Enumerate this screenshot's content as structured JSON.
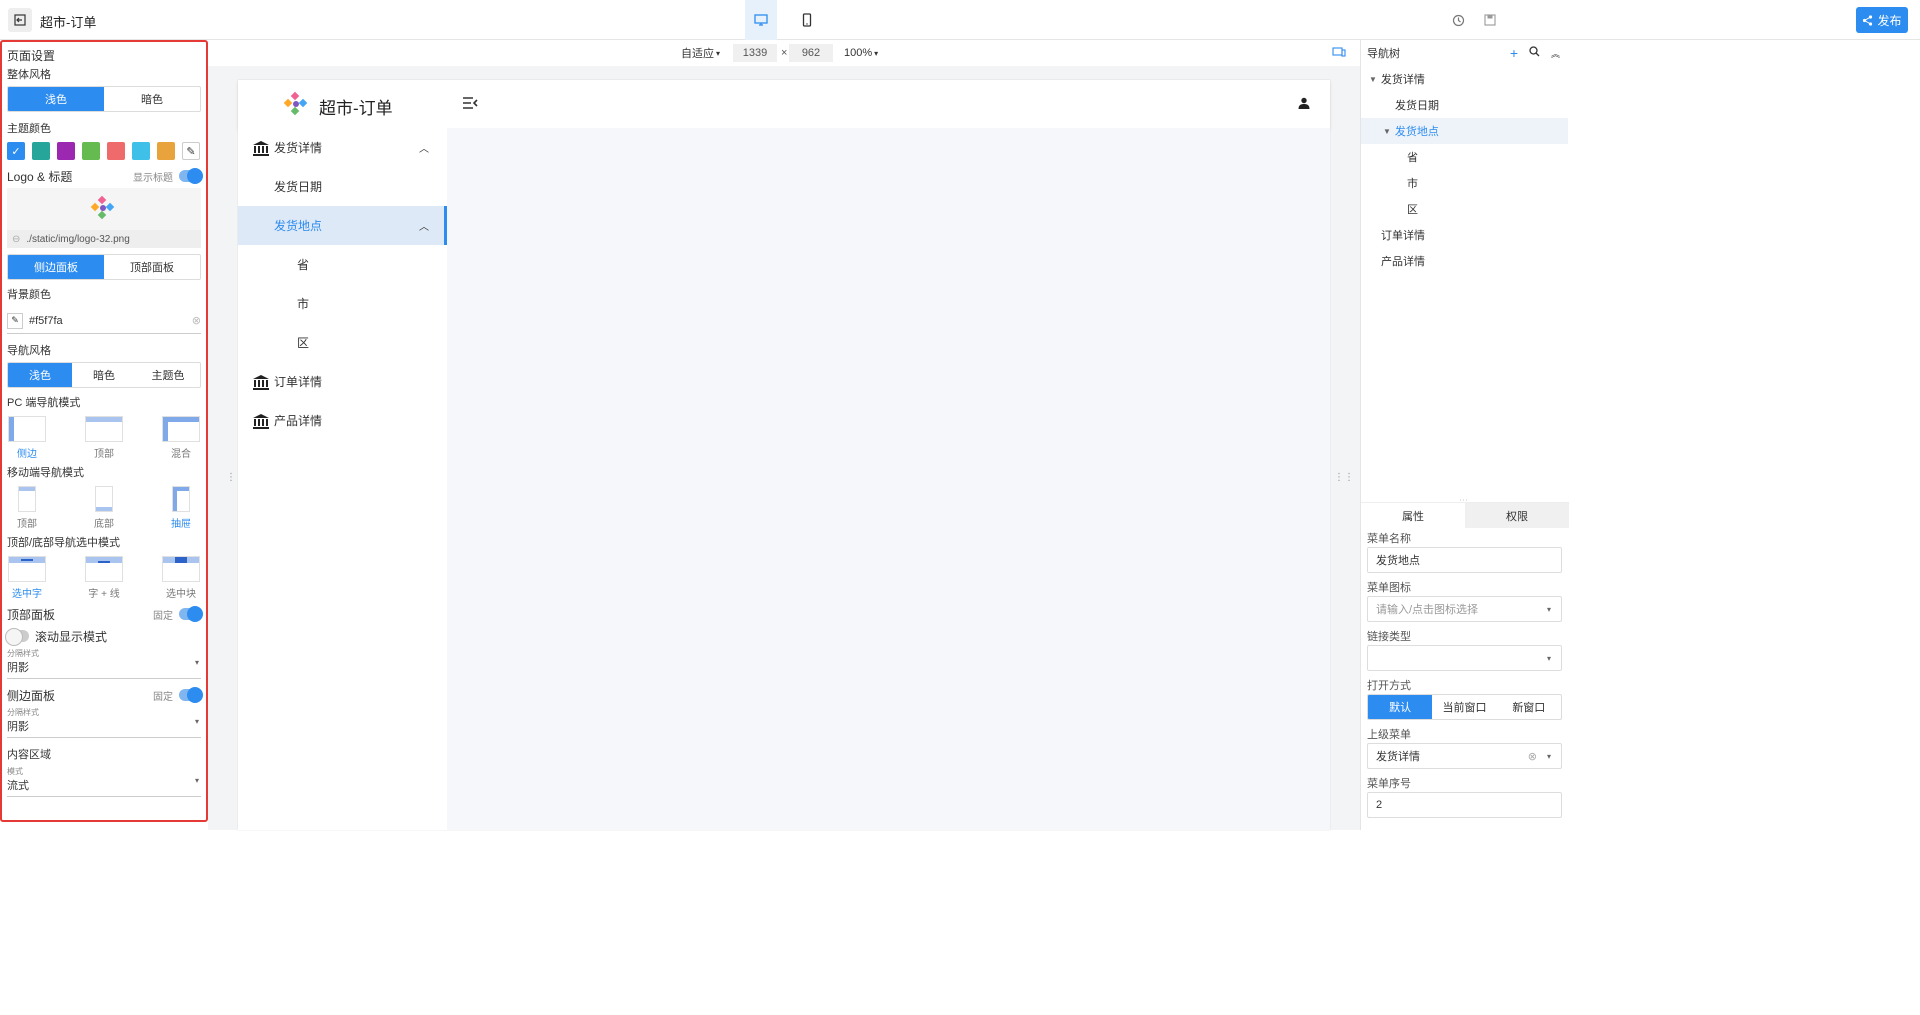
{
  "header": {
    "title": "超市-订单",
    "publish_label": "发布",
    "accent": "#2d8cf0"
  },
  "left_panel": {
    "section_title": "页面设置",
    "overall_style_label": "整体风格",
    "overall_style_options": [
      "浅色",
      "暗色"
    ],
    "theme_color_label": "主题颜色",
    "theme_colors": [
      "#2d8cf0",
      "#26a69a",
      "#9c27b0",
      "#66bb50",
      "#ef6b6b",
      "#3ec0e8",
      "#e8a33d"
    ],
    "logo_title_label": "Logo & 标题",
    "show_title_label": "显示标题",
    "logo_path": "./static/img/logo-32.png",
    "panel_options": [
      "侧边面板",
      "顶部面板"
    ],
    "bg_color_label": "背景颜色",
    "bg_color_value": "#f5f7fa",
    "nav_style_label": "导航风格",
    "nav_style_options": [
      "浅色",
      "暗色",
      "主题色"
    ],
    "pc_nav_label": "PC 端导航模式",
    "pc_nav_options": [
      "侧边",
      "顶部",
      "混合"
    ],
    "mobile_nav_label": "移动端导航模式",
    "mobile_nav_options": [
      "顶部",
      "底部",
      "抽屉"
    ],
    "select_mode_label": "顶部/底部导航选中模式",
    "select_mode_options": [
      "选中字",
      "字 + 线",
      "选中块"
    ],
    "top_panel_label": "顶部面板",
    "fixed_label": "固定",
    "scroll_mode_label": "滚动显示模式",
    "divider_style_caption": "分隔样式",
    "divider_style_value": "阴影",
    "side_panel_label": "侧边面板",
    "side_fixed_label": "固定",
    "side_divider_caption": "分隔样式",
    "side_divider_value": "阴影",
    "content_area_label": "内容区域",
    "mode_caption": "模式",
    "mode_value": "流式"
  },
  "canvas_toolbar": {
    "fit_label": "自适应",
    "width": "1339",
    "times": "×",
    "height": "962",
    "zoom": "100%"
  },
  "preview": {
    "title": "超市-订单",
    "nav": [
      {
        "label": "发货详情"
      },
      {
        "label": "发货日期"
      },
      {
        "label": "发货地点"
      },
      {
        "label": "省"
      },
      {
        "label": "市"
      },
      {
        "label": "区"
      },
      {
        "label": "订单详情"
      },
      {
        "label": "产品详情"
      }
    ]
  },
  "right_panel": {
    "tree_title": "导航树",
    "tree": [
      {
        "label": "发货详情"
      },
      {
        "label": "发货日期"
      },
      {
        "label": "发货地点"
      },
      {
        "label": "省"
      },
      {
        "label": "市"
      },
      {
        "label": "区"
      },
      {
        "label": "订单详情"
      },
      {
        "label": "产品详情"
      }
    ],
    "tabs": [
      "属性",
      "权限"
    ],
    "menu_name_label": "菜单名称",
    "menu_name_value": "发货地点",
    "menu_icon_label": "菜单图标",
    "menu_icon_placeholder": "请输入/点击图标选择",
    "link_type_label": "链接类型",
    "open_mode_label": "打开方式",
    "open_mode_options": [
      "默认",
      "当前窗口",
      "新窗口"
    ],
    "parent_menu_label": "上级菜单",
    "parent_menu_value": "发货详情",
    "menu_order_label": "菜单序号",
    "menu_order_value": "2"
  }
}
